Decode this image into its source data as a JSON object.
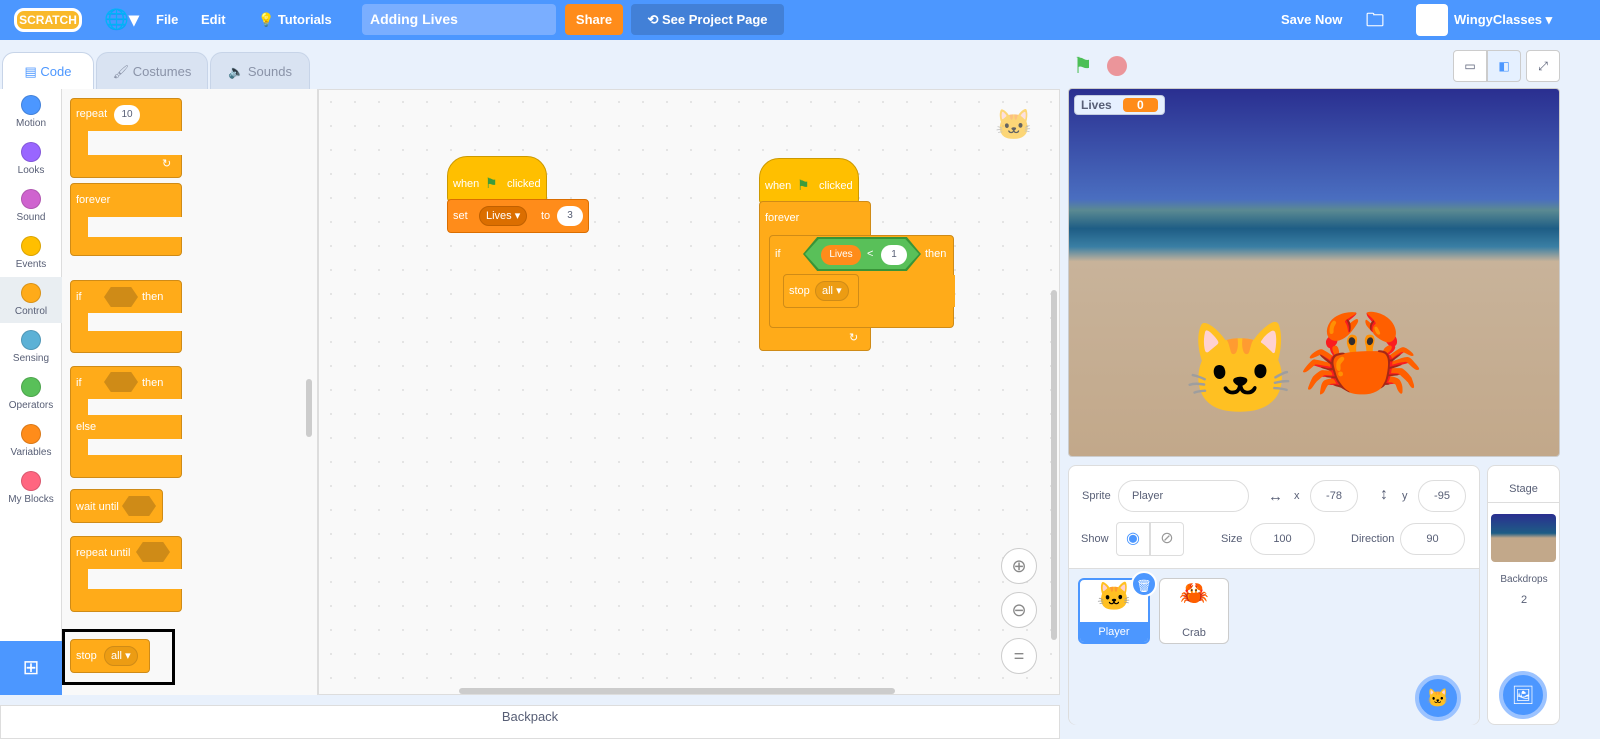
{
  "topbar": {
    "logo": "SCRATCH",
    "language_icon": "globe-icon",
    "file": "File",
    "edit": "Edit",
    "tutorials": "Tutorials",
    "project_title": "Adding Lives",
    "share": "Share",
    "see_project_page": "See Project Page",
    "save_now": "Save Now",
    "username": "WingyClasses",
    "accent": "#4c97ff"
  },
  "tabs": [
    {
      "label": "Code"
    },
    {
      "label": "Costumes"
    },
    {
      "label": "Sounds"
    }
  ],
  "categories": [
    {
      "label": "Motion",
      "color": "#4c97ff"
    },
    {
      "label": "Looks",
      "color": "#9966ff"
    },
    {
      "label": "Sound",
      "color": "#cf63cf"
    },
    {
      "label": "Events",
      "color": "#ffbf00"
    },
    {
      "label": "Control",
      "color": "#ffab19"
    },
    {
      "label": "Sensing",
      "color": "#5cb1d6"
    },
    {
      "label": "Operators",
      "color": "#59c059"
    },
    {
      "label": "Variables",
      "color": "#ff8c1a"
    },
    {
      "label": "My Blocks",
      "color": "#ff6680"
    }
  ],
  "palette": {
    "repeat": "repeat",
    "repeat_count": "10",
    "forever": "forever",
    "if": "if",
    "then": "then",
    "else": "else",
    "wait_until": "wait until",
    "repeat_until": "repeat until",
    "stop": "stop",
    "stop_option": "all"
  },
  "scripts": {
    "s1": {
      "hat": "when",
      "clicked": "clicked",
      "set": "set",
      "var": "Lives",
      "to": "to",
      "value": "3"
    },
    "s2": {
      "hat": "when",
      "clicked": "clicked",
      "forever": "forever",
      "if": "if",
      "var": "Lives",
      "op": "<",
      "value": "1",
      "then": "then",
      "stop": "stop",
      "stop_option": "all"
    }
  },
  "backpack": "Backpack",
  "stage": {
    "monitor_label": "Lives",
    "monitor_value": "0"
  },
  "sprite_info": {
    "sprite_label": "Sprite",
    "sprite_name": "Player",
    "x_label": "x",
    "x": "-78",
    "y_label": "y",
    "y": "-95",
    "show_label": "Show",
    "size_label": "Size",
    "size": "100",
    "direction_label": "Direction",
    "direction": "90"
  },
  "sprites": [
    {
      "name": "Player",
      "selected": true
    },
    {
      "name": "Crab",
      "selected": false
    }
  ],
  "stage_pane": {
    "title": "Stage",
    "backdrops_label": "Backdrops",
    "backdrops_count": "2"
  }
}
